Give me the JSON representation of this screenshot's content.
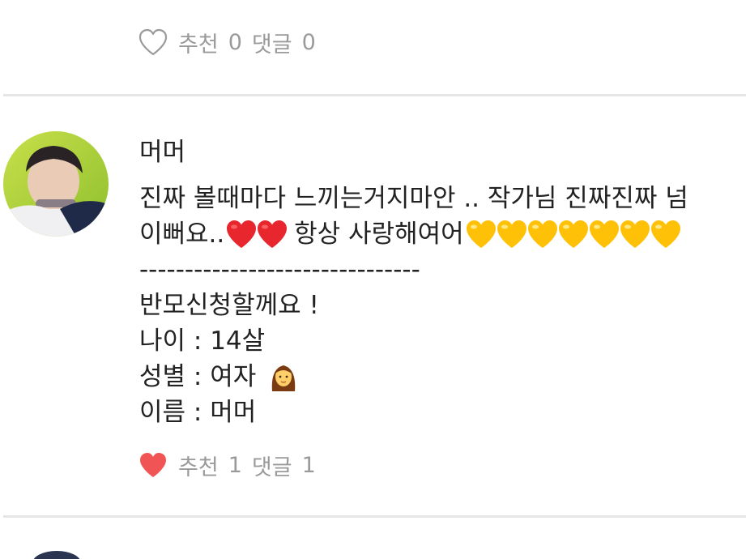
{
  "previous_comment": {
    "recommend_label": "추천",
    "recommend_count": "0",
    "reply_label": "댓글",
    "reply_count": "0",
    "liked": false
  },
  "comment": {
    "author": "머머",
    "lines": [
      "진짜 볼때마다 느끼는거지마안 ..  작가님 진짜진짜 넘",
      "이뻐요..",
      " 항상 사랑해여어",
      "-------------------------------",
      "반모신청할께요 !",
      "나이 : 14살",
      "성별 : 여자 ",
      "이름 : 머머"
    ],
    "red_hearts": 2,
    "yellow_hearts": 7,
    "recommend_label": "추천",
    "recommend_count": "1",
    "reply_label": "댓글",
    "reply_count": "1",
    "liked": true,
    "like_color": "#f05454"
  },
  "colors": {
    "meta_text": "#9a9a9a",
    "divider": "#e6e6e6",
    "red_heart": "#e8262e",
    "yellow_heart": "#ffc107"
  },
  "icons": {
    "like_outline": "heart-outline-icon",
    "like_filled": "heart-filled-icon",
    "red_heart_emoji": "red-heart-emoji",
    "yellow_heart_emoji": "yellow-heart-emoji",
    "woman_emoji": "woman-emoji"
  }
}
